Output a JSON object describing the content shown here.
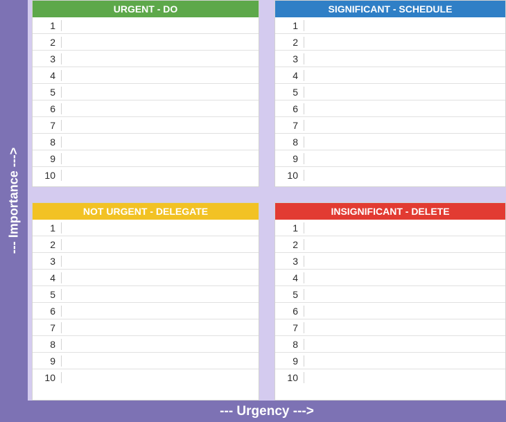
{
  "axes": {
    "y_label": "--- Importance --->",
    "x_label": "--- Urgency --->"
  },
  "quadrants": {
    "urgent_do": {
      "title": "URGENT - DO",
      "color": "#5da84a",
      "rows": [
        {
          "n": "1",
          "text": ""
        },
        {
          "n": "2",
          "text": ""
        },
        {
          "n": "3",
          "text": ""
        },
        {
          "n": "4",
          "text": ""
        },
        {
          "n": "5",
          "text": ""
        },
        {
          "n": "6",
          "text": ""
        },
        {
          "n": "7",
          "text": ""
        },
        {
          "n": "8",
          "text": ""
        },
        {
          "n": "9",
          "text": ""
        },
        {
          "n": "10",
          "text": ""
        }
      ]
    },
    "significant_schedule": {
      "title": "SIGNIFICANT - SCHEDULE",
      "color": "#2f7fc6",
      "rows": [
        {
          "n": "1",
          "text": ""
        },
        {
          "n": "2",
          "text": ""
        },
        {
          "n": "3",
          "text": ""
        },
        {
          "n": "4",
          "text": ""
        },
        {
          "n": "5",
          "text": ""
        },
        {
          "n": "6",
          "text": ""
        },
        {
          "n": "7",
          "text": ""
        },
        {
          "n": "8",
          "text": ""
        },
        {
          "n": "9",
          "text": ""
        },
        {
          "n": "10",
          "text": ""
        }
      ]
    },
    "not_urgent_delegate": {
      "title": "NOT URGENT - DELEGATE",
      "color": "#f2c224",
      "rows": [
        {
          "n": "1",
          "text": ""
        },
        {
          "n": "2",
          "text": ""
        },
        {
          "n": "3",
          "text": ""
        },
        {
          "n": "4",
          "text": ""
        },
        {
          "n": "5",
          "text": ""
        },
        {
          "n": "6",
          "text": ""
        },
        {
          "n": "7",
          "text": ""
        },
        {
          "n": "8",
          "text": ""
        },
        {
          "n": "9",
          "text": ""
        },
        {
          "n": "10",
          "text": ""
        }
      ]
    },
    "insignificant_delete": {
      "title": "INSIGNIFICANT - DELETE",
      "color": "#e23b32",
      "rows": [
        {
          "n": "1",
          "text": ""
        },
        {
          "n": "2",
          "text": ""
        },
        {
          "n": "3",
          "text": ""
        },
        {
          "n": "4",
          "text": ""
        },
        {
          "n": "5",
          "text": ""
        },
        {
          "n": "6",
          "text": ""
        },
        {
          "n": "7",
          "text": ""
        },
        {
          "n": "8",
          "text": ""
        },
        {
          "n": "9",
          "text": ""
        },
        {
          "n": "10",
          "text": ""
        }
      ]
    }
  }
}
